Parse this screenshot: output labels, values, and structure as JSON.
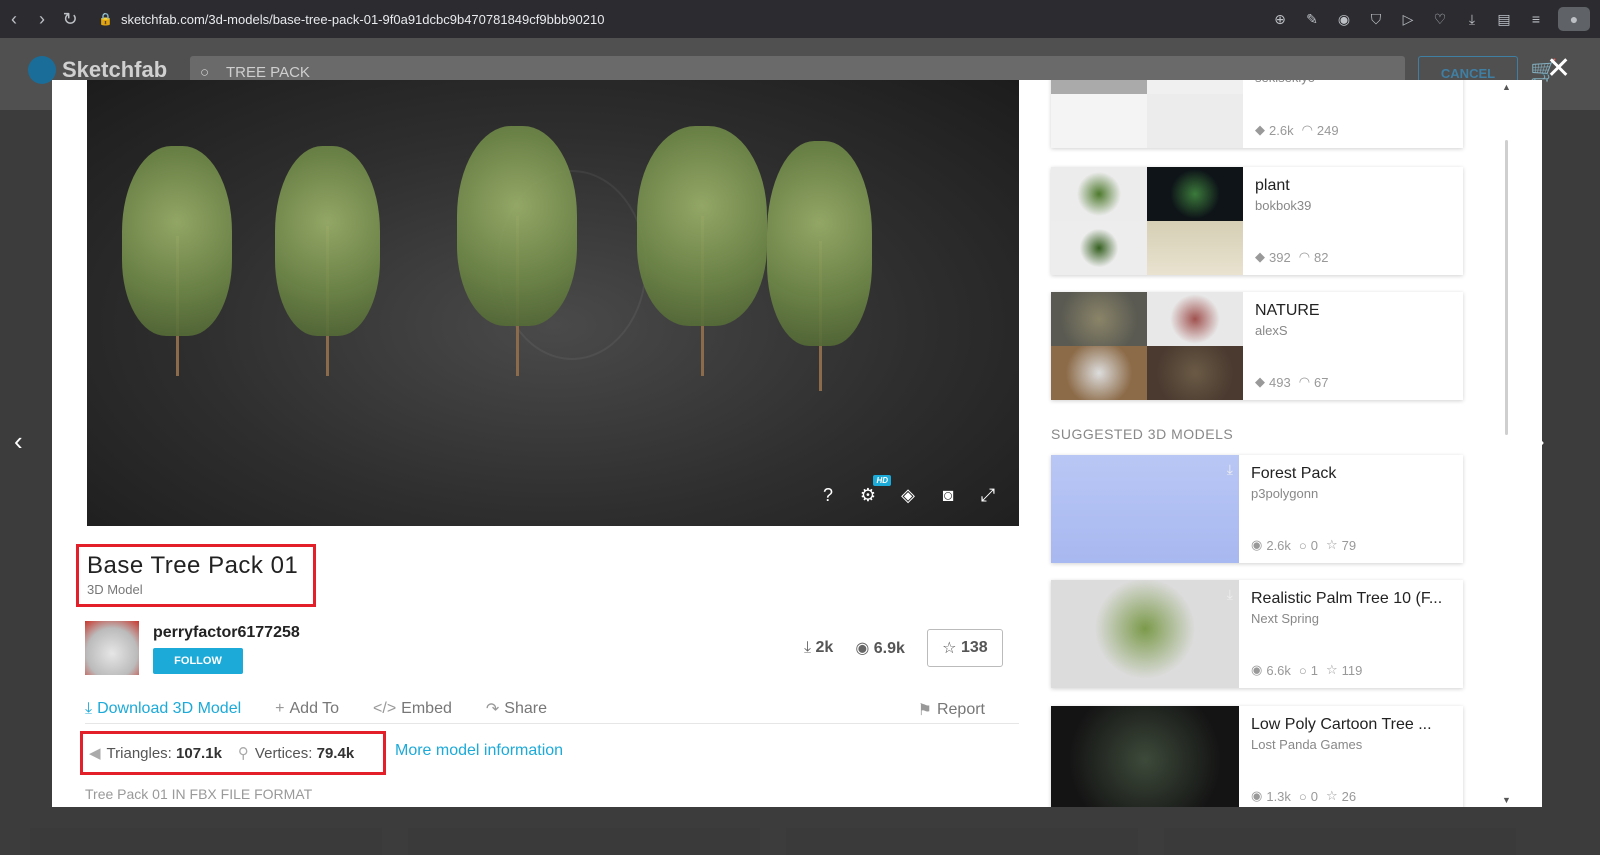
{
  "browser": {
    "url": "sketchfab.com/3d-models/base-tree-pack-01-9f0a91dcbc9b470781849cf9bbb90210"
  },
  "site": {
    "logo_text": "Sketchfab",
    "search_value": "TREE PACK",
    "cancel_label": "CANCEL"
  },
  "model": {
    "title": "Base Tree Pack 01",
    "type": "3D Model",
    "author": "perryfactor6177258",
    "follow_label": "FOLLOW",
    "downloads": "2k",
    "views": "6.9k",
    "likes": "138",
    "hd_badge": "HD",
    "help_icon": "?",
    "actions": {
      "download": "Download 3D Model",
      "add_to": "Add To",
      "embed": "Embed",
      "share": "Share",
      "report": "Report"
    },
    "triangles_label": "Triangles:",
    "triangles_value": "107.1k",
    "vertices_label": "Vertices:",
    "vertices_value": "79.4k",
    "more_info": "More model information",
    "description": "Tree Pack 01 IN FBX FILE FORMAT"
  },
  "sidebar": {
    "collections": [
      {
        "name": "",
        "user": "sekisekiyo",
        "models": "2.6k",
        "subscribers": "249"
      },
      {
        "name": "plant",
        "user": "bokbok39",
        "models": "392",
        "subscribers": "82"
      },
      {
        "name": "NATURE",
        "user": "alexS",
        "models": "493",
        "subscribers": "67"
      }
    ],
    "suggested_label": "SUGGESTED 3D MODELS",
    "suggested": [
      {
        "name": "Forest Pack",
        "user": "p3polygonn",
        "views": "2.6k",
        "comments": "0",
        "likes": "79"
      },
      {
        "name": "Realistic Palm Tree 10 (F...",
        "user": "Next Spring",
        "views": "6.6k",
        "comments": "1",
        "likes": "119"
      },
      {
        "name": "Low Poly Cartoon Tree ...",
        "user": "Lost Panda Games",
        "views": "1.3k",
        "comments": "0",
        "likes": "26"
      }
    ]
  },
  "colors": {
    "accent": "#1caad9",
    "highlight_box": "#e3202a"
  }
}
